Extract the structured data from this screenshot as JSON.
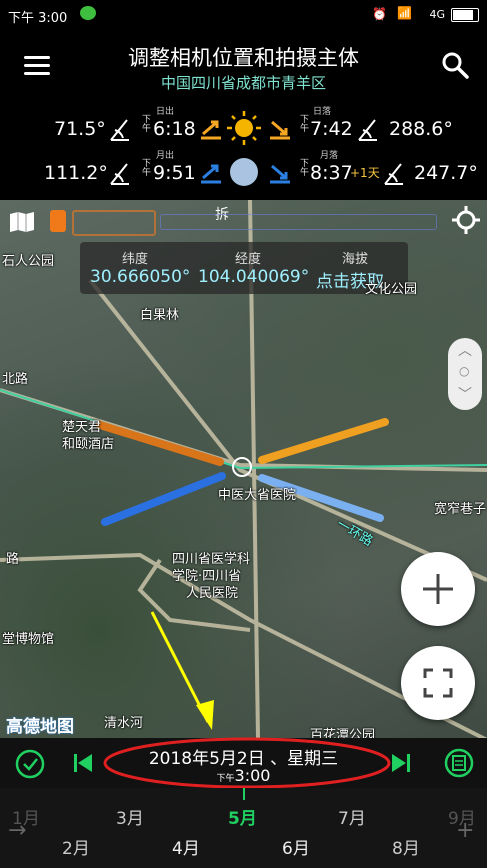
{
  "status_bar": {
    "time": "下午 3:00",
    "network": "4G"
  },
  "header": {
    "title": "调整相机位置和拍摄主体",
    "subtitle": "中国四川省成都市青羊区"
  },
  "sun": {
    "rise_azimuth": "71.5°",
    "rise_label": "日出",
    "rise_time": "6:18",
    "set_label": "日落",
    "set_time": "7:42",
    "set_azimuth": "288.6°"
  },
  "moon": {
    "rise_azimuth": "111.2°",
    "rise_label": "月出",
    "rise_time": "9:51",
    "set_label": "月落",
    "set_time": "8:37",
    "set_note": "+1天",
    "set_azimuth": "247.7°"
  },
  "info_panel": {
    "lat_label": "纬度",
    "lat_value": "30.666050°",
    "lng_label": "经度",
    "lng_value": "104.040069°",
    "alt_label": "海拔",
    "alt_value": "点击获取"
  },
  "map_labels": {
    "stone_park": "石人公园",
    "baiguo": "白果林",
    "north_road": "北路",
    "hotel1": "楚天君",
    "hotel2": "和颐酒店",
    "hospital_area": "中医大省医院",
    "hospital1": "四川省医学科",
    "hospital2": "学院·四川省",
    "hospital3": "人民医院",
    "museum": "堂博物馆",
    "road2": "路",
    "kuanzhai": "宽窄巷子",
    "baihuatan": "百花潭公园",
    "qingshui": "清水河",
    "park_right": "文化公园",
    "ring": "一环路",
    "pull": "拆"
  },
  "logo": "高德地图",
  "date_bar": {
    "date": "2018年5月2日 、星期三",
    "time_prefix": "下午",
    "time": "3:00"
  },
  "months": {
    "m1": "1月",
    "m2": "2月",
    "m3": "3月",
    "m4": "4月",
    "m5": "5月",
    "m6": "6月",
    "m7": "7月",
    "m8": "8月",
    "m9": "9月"
  },
  "colors": {
    "accent_green": "#20d060",
    "sun_orange": "#f5a623",
    "moon_blue": "#2a7fe0",
    "subtitle": "#7fe3d0",
    "highlight_red": "#e02020",
    "arrow_yellow": "#ffff00"
  }
}
